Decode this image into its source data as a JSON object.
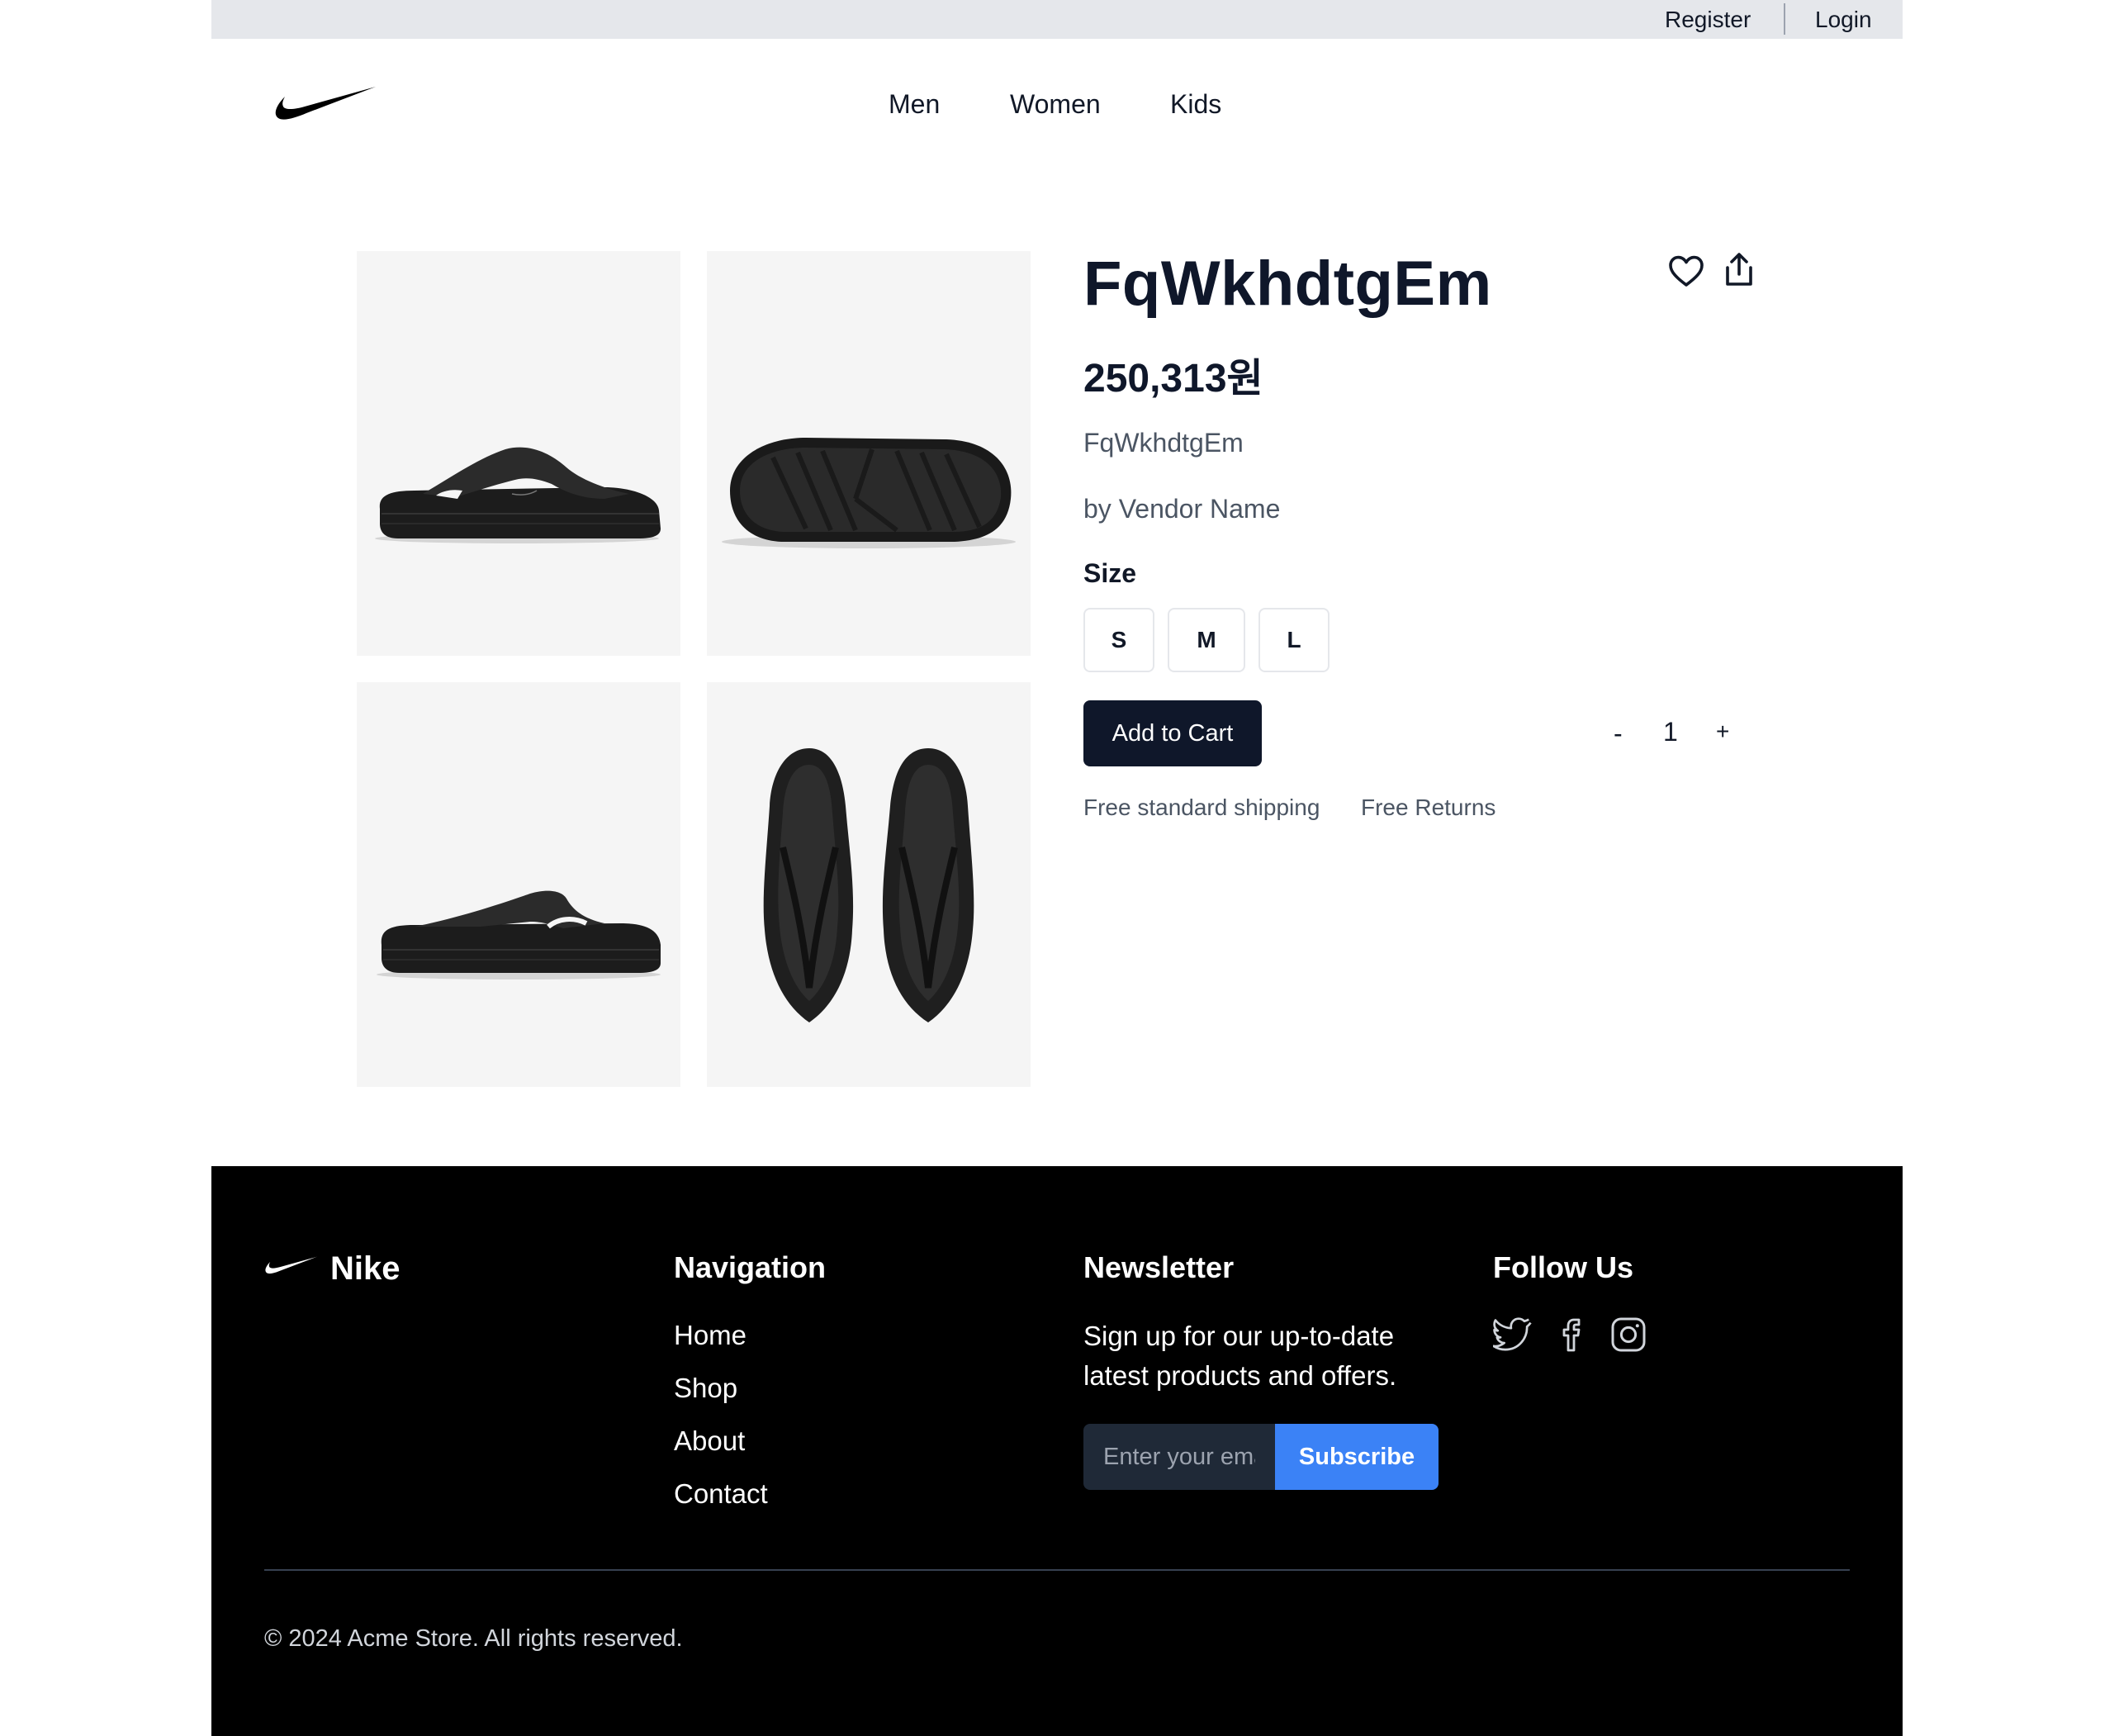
{
  "topbar": {
    "register": "Register",
    "login": "Login"
  },
  "header": {
    "logo_icon": "nike-swoosh-icon",
    "nav": [
      "Men",
      "Women",
      "Kids"
    ]
  },
  "gallery": {
    "images": [
      "sandal-side-view",
      "sandal-sole-view",
      "sandal-side-view-alt",
      "sandal-pair-top-view"
    ]
  },
  "product": {
    "title": "FqWkhdtgEm",
    "price": "250,313원",
    "subtitle": "FqWkhdtgEm",
    "vendor": "by Vendor Name",
    "size_label": "Size",
    "sizes": [
      "S",
      "M",
      "L"
    ],
    "add_to_cart": "Add to Cart",
    "quantity": {
      "minus": "-",
      "value": "1",
      "plus": "+"
    },
    "perks": [
      "Free standard shipping",
      "Free Returns"
    ],
    "icons": [
      "heart-icon",
      "share-icon"
    ]
  },
  "footer": {
    "brand": "Nike",
    "nav_heading": "Navigation",
    "nav_links": [
      "Home",
      "Shop",
      "About",
      "Contact"
    ],
    "newsletter_heading": "Newsletter",
    "newsletter_text": "Sign up for our up-to-date latest products and offers.",
    "email_placeholder": "Enter your email",
    "subscribe_label": "Subscribe",
    "follow_heading": "Follow Us",
    "social_icons": [
      "twitter-icon",
      "facebook-icon",
      "instagram-icon"
    ],
    "copyright": "© 2024 Acme Store. All rights reserved."
  },
  "colors": {
    "topbar_bg": "#e5e7eb",
    "primary_dark": "#0f172a",
    "subscribe_blue": "#3b82f6",
    "footer_bg": "#000000",
    "tile_bg": "#f5f5f5"
  }
}
